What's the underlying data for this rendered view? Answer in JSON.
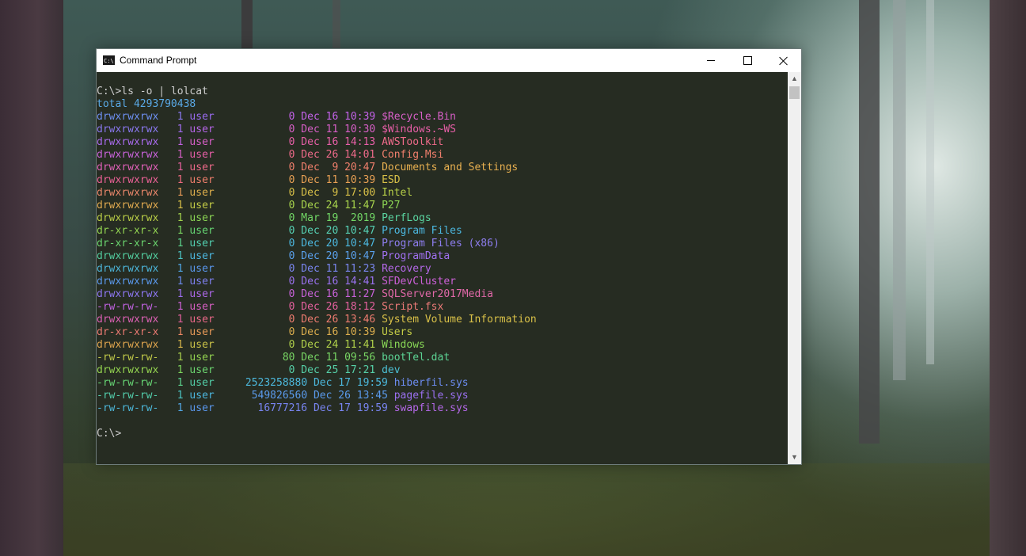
{
  "window": {
    "title": "Command Prompt",
    "icon_label": "C:\\.",
    "icon": "cmd-icon",
    "controls": [
      "minimize-icon",
      "maximize-icon",
      "close-icon"
    ]
  },
  "console": {
    "background": "#262c22",
    "lines": [
      {
        "segments": [
          {
            "text": "C:\\>ls -o | lolcat",
            "color": "#cccccc"
          }
        ]
      },
      {
        "segments": [
          {
            "text": "total 4293790438",
            "color": "#5aa9e6"
          }
        ]
      },
      {
        "segments": [
          {
            "text": "drwxrwxrwx",
            "color": "#6d8ff0"
          },
          {
            "text": "   1 ",
            "color": "#8a78f0"
          },
          {
            "text": "user            ",
            "color": "#9a6cf2"
          },
          {
            "text": "0 Dec 16 10:39 ",
            "color": "#c462ea"
          },
          {
            "text": "$Recycle.Bin",
            "color": "#d85fc8"
          }
        ]
      },
      {
        "segments": [
          {
            "text": "drwxrwxrwx",
            "color": "#8a78f0"
          },
          {
            "text": "   1 ",
            "color": "#a16cf0"
          },
          {
            "text": "user            ",
            "color": "#b665e8"
          },
          {
            "text": "0 Dec 11 10:30 ",
            "color": "#d85fc8"
          },
          {
            "text": "$Windows.~WS",
            "color": "#e85fa8"
          }
        ]
      },
      {
        "segments": [
          {
            "text": "drwxrwxrwx",
            "color": "#a86aec"
          },
          {
            "text": "   1 ",
            "color": "#c062e2"
          },
          {
            "text": "user            ",
            "color": "#d85fc8"
          },
          {
            "text": "0 Dec 16 14:13 ",
            "color": "#e85fa8"
          },
          {
            "text": "AWSToolkit",
            "color": "#ee6a8a"
          }
        ]
      },
      {
        "segments": [
          {
            "text": "drwxrwxrwx",
            "color": "#c862da"
          },
          {
            "text": "   1 ",
            "color": "#d85fc8"
          },
          {
            "text": "user            ",
            "color": "#e85fa8"
          },
          {
            "text": "0 Dec 26 14:01 ",
            "color": "#ee6a8a"
          },
          {
            "text": "Config.Msi",
            "color": "#f07f6c"
          }
        ]
      },
      {
        "segments": [
          {
            "text": "drwxrwxrwx",
            "color": "#e060b8"
          },
          {
            "text": "   1 ",
            "color": "#e8609e"
          },
          {
            "text": "user            ",
            "color": "#ee6a8a"
          },
          {
            "text": "0 Dec  9 20:47 ",
            "color": "#f07f6c"
          },
          {
            "text": "Documents and Settings",
            "color": "#e8b050"
          }
        ]
      },
      {
        "segments": [
          {
            "text": "drwxrwxrwx",
            "color": "#ea6096"
          },
          {
            "text": "   1 ",
            "color": "#ee6a80"
          },
          {
            "text": "user            ",
            "color": "#f07f6c"
          },
          {
            "text": "0 Dec 11 10:39 ",
            "color": "#e8a054"
          },
          {
            "text": "ESD",
            "color": "#d8c048"
          }
        ]
      },
      {
        "segments": [
          {
            "text": "drwxrwxrwx",
            "color": "#e8866a"
          },
          {
            "text": "   1 ",
            "color": "#e89a58"
          },
          {
            "text": "user            ",
            "color": "#e0b04c"
          },
          {
            "text": "0 Dec  9 17:00 ",
            "color": "#d8c048"
          },
          {
            "text": "Intel",
            "color": "#b8d048"
          }
        ]
      },
      {
        "segments": [
          {
            "text": "drwxrwxrwx",
            "color": "#e0aa50"
          },
          {
            "text": "   1 ",
            "color": "#d8c048"
          },
          {
            "text": "user            ",
            "color": "#c4cc46"
          },
          {
            "text": "0 Dec 24 11:47 ",
            "color": "#a8d44c"
          },
          {
            "text": "P27",
            "color": "#8cd654"
          }
        ]
      },
      {
        "segments": [
          {
            "text": "drwxrwxrwx",
            "color": "#b8cc46"
          },
          {
            "text": "   1 ",
            "color": "#a2d24c"
          },
          {
            "text": "user            ",
            "color": "#8cd654"
          },
          {
            "text": "0 Mar 19  2019 ",
            "color": "#72d866"
          },
          {
            "text": "PerfLogs",
            "color": "#5ad4a0"
          }
        ]
      },
      {
        "segments": [
          {
            "text": "dr-xr-xr-x",
            "color": "#92d452"
          },
          {
            "text": "   1 ",
            "color": "#7ad660"
          },
          {
            "text": "user            ",
            "color": "#66d674"
          },
          {
            "text": "0 Dec 20 10:47 ",
            "color": "#56d0b4"
          },
          {
            "text": "Program Files",
            "color": "#4cb8e0"
          }
        ]
      },
      {
        "segments": [
          {
            "text": "dr-xr-xr-x",
            "color": "#6ad46e"
          },
          {
            "text": "   1 ",
            "color": "#5cd48c"
          },
          {
            "text": "user            ",
            "color": "#52cfb0"
          },
          {
            "text": "0 Dec 20 10:47 ",
            "color": "#4cb8e0"
          },
          {
            "text": "Program Files (x86)",
            "color": "#8e7ef0"
          }
        ]
      },
      {
        "segments": [
          {
            "text": "drwxrwxrwx",
            "color": "#52cc9e"
          },
          {
            "text": "   1 ",
            "color": "#4cc4c4"
          },
          {
            "text": "user            ",
            "color": "#4cb8e0"
          },
          {
            "text": "0 Dec 20 10:47 ",
            "color": "#5aa0ec"
          },
          {
            "text": "ProgramData",
            "color": "#a070f0"
          }
        ]
      },
      {
        "segments": [
          {
            "text": "drwxrwxrwx",
            "color": "#4cb4d8"
          },
          {
            "text": "   1 ",
            "color": "#50a8e8"
          },
          {
            "text": "user            ",
            "color": "#5a98ee"
          },
          {
            "text": "0 Dec 11 11:23 ",
            "color": "#7a86f0"
          },
          {
            "text": "Recovery",
            "color": "#b468e8"
          }
        ]
      },
      {
        "segments": [
          {
            "text": "drwxrwxrwx",
            "color": "#5a98ec"
          },
          {
            "text": "   1 ",
            "color": "#6c8cf0"
          },
          {
            "text": "user            ",
            "color": "#7e80f0"
          },
          {
            "text": "0 Dec 16 14:41 ",
            "color": "#9a72f0"
          },
          {
            "text": "SFDevCluster",
            "color": "#cc60d8"
          }
        ]
      },
      {
        "segments": [
          {
            "text": "drwxrwxrwx",
            "color": "#8c76f0"
          },
          {
            "text": "   1 ",
            "color": "#9c6ef0"
          },
          {
            "text": "user            ",
            "color": "#ae68ea"
          },
          {
            "text": "0 Dec 16 11:27 ",
            "color": "#c862da"
          },
          {
            "text": "SQLServer2017Media",
            "color": "#e068a8"
          }
        ]
      },
      {
        "segments": [
          {
            "text": "-rw-rw-rw-",
            "color": "#c062e0"
          },
          {
            "text": "   1 ",
            "color": "#cc60d6"
          },
          {
            "text": "user            ",
            "color": "#d860c4"
          },
          {
            "text": "0 Dec 26 18:12 ",
            "color": "#e4609e"
          },
          {
            "text": "Script.fsx",
            "color": "#ec7a78"
          }
        ]
      },
      {
        "segments": [
          {
            "text": "drwxrwxrwx",
            "color": "#dc60b4"
          },
          {
            "text": "   1 ",
            "color": "#e4609e"
          },
          {
            "text": "user            ",
            "color": "#ea6888"
          },
          {
            "text": "0 Dec 26 13:46 ",
            "color": "#ee7c70"
          },
          {
            "text": "System Volume Information",
            "color": "#d8c048"
          }
        ]
      },
      {
        "segments": [
          {
            "text": "dr-xr-xr-x",
            "color": "#ea7a72"
          },
          {
            "text": "   1 ",
            "color": "#ec8864"
          },
          {
            "text": "user            ",
            "color": "#e89a58"
          },
          {
            "text": "0 Dec 16 10:39 ",
            "color": "#dcae4e"
          },
          {
            "text": "Users",
            "color": "#c4cc46"
          }
        ]
      },
      {
        "segments": [
          {
            "text": "drwxrwxrwx",
            "color": "#dca44e"
          },
          {
            "text": "   1 ",
            "color": "#d8b64a"
          },
          {
            "text": "user            ",
            "color": "#ccc448"
          },
          {
            "text": "0 Dec 24 11:41 ",
            "color": "#b0d04a"
          },
          {
            "text": "Windows",
            "color": "#88d656"
          }
        ]
      },
      {
        "segments": [
          {
            "text": "-rw-rw-rw-",
            "color": "#c0c848"
          },
          {
            "text": "   1 ",
            "color": "#aad04c"
          },
          {
            "text": "user           ",
            "color": "#94d450"
          },
          {
            "text": "80 Dec 11 09:56 ",
            "color": "#78d664"
          },
          {
            "text": "bootTel.dat",
            "color": "#5cd494"
          }
        ]
      },
      {
        "segments": [
          {
            "text": "drwxrwxrwx",
            "color": "#94d450"
          },
          {
            "text": "   1 ",
            "color": "#7ed65c"
          },
          {
            "text": "user            ",
            "color": "#6cd670"
          },
          {
            "text": "0 Dec 25 17:21 ",
            "color": "#56d0a8"
          },
          {
            "text": "dev",
            "color": "#4cc0d4"
          }
        ]
      },
      {
        "segments": [
          {
            "text": "-rw-rw-rw-",
            "color": "#66d474"
          },
          {
            "text": "   1 ",
            "color": "#5cd28c"
          },
          {
            "text": "user     ",
            "color": "#52cea8"
          },
          {
            "text": "2523258880 Dec 17 19:59 ",
            "color": "#4cb8dc"
          },
          {
            "text": "hiberfil.sys",
            "color": "#6c8cf0"
          }
        ]
      },
      {
        "segments": [
          {
            "text": "-rw-rw-rw-",
            "color": "#52ccaa"
          },
          {
            "text": "   1 ",
            "color": "#4cc4c4"
          },
          {
            "text": "user      ",
            "color": "#4cb8e0"
          },
          {
            "text": "549826560 Dec 26 13:45 ",
            "color": "#5a9aec"
          },
          {
            "text": "pagefile.sys",
            "color": "#9a70f0"
          }
        ]
      },
      {
        "segments": [
          {
            "text": "-rw-rw-rw-",
            "color": "#4cb6d8"
          },
          {
            "text": "   1 ",
            "color": "#52a8e6"
          },
          {
            "text": "user       ",
            "color": "#5a98ee"
          },
          {
            "text": "16777216 Dec 17 19:59 ",
            "color": "#7884f0"
          },
          {
            "text": "swapfile.sys",
            "color": "#b468e8"
          }
        ]
      },
      {
        "segments": [
          {
            "text": "",
            "color": "#cccccc"
          }
        ]
      },
      {
        "segments": [
          {
            "text": "C:\\>",
            "color": "#cccccc"
          }
        ]
      }
    ]
  },
  "scrollbar": {
    "up_icon": "chevron-up-icon",
    "down_icon": "chevron-down-icon",
    "thumb_position": 0.0
  }
}
